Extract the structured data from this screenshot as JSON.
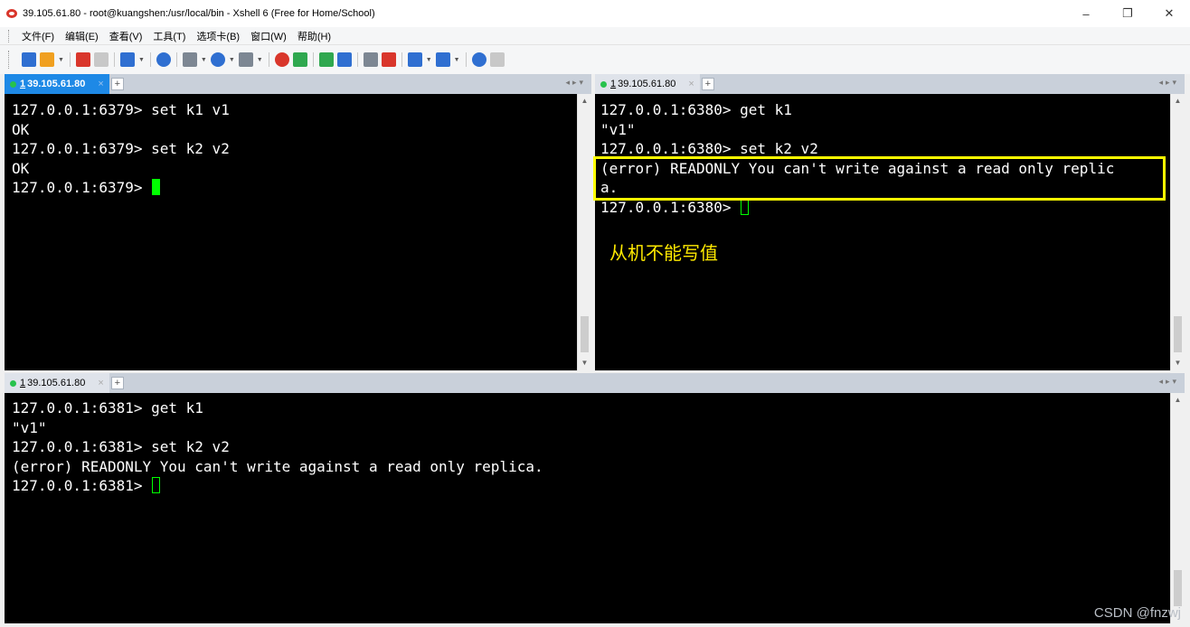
{
  "window": {
    "title": "39.105.61.80 - root@kuangshen:/usr/local/bin - Xshell 6 (Free for Home/School)",
    "controls": {
      "minimize": "–",
      "maximize": "❐",
      "close": "✕"
    }
  },
  "menu": [
    "文件(F)",
    "编辑(E)",
    "查看(V)",
    "工具(T)",
    "选项卡(B)",
    "窗口(W)",
    "帮助(H)"
  ],
  "toolbar": {
    "icons": [
      "new-session-icon",
      "open-folder-icon",
      "reconnect-icon",
      "disconnect-icon",
      "properties-icon",
      "find-icon",
      "transfer-icon",
      "globe-icon",
      "font-icon",
      "xshell-logo-icon",
      "xftp-icon",
      "fullscreen-icon",
      "lock-icon",
      "keyboard-icon",
      "script-icon",
      "layout-icon",
      "tab-layout-icon",
      "help-icon",
      "chat-icon"
    ],
    "colors": {
      "blue": "#2f6fd1",
      "orange": "#f0a020",
      "red": "#d9362b",
      "green": "#2fa84f",
      "gray": "#7d8793"
    }
  },
  "panes": {
    "top_left": {
      "tab": {
        "num": "1",
        "label": "39.105.61.80"
      },
      "lines": [
        "127.0.0.1:6379> set k1 v1",
        "OK",
        "127.0.0.1:6379> set k2 v2",
        "OK",
        "127.0.0.1:6379> "
      ]
    },
    "top_right": {
      "tab": {
        "num": "1",
        "label": "39.105.61.80"
      },
      "lines": [
        "127.0.0.1:6380> get k1",
        "\"v1\"",
        "127.0.0.1:6380> set k2 v2",
        "(error) READONLY You can't write against a read only replic",
        "a.",
        "127.0.0.1:6380> "
      ],
      "annotation": "从机不能写值"
    },
    "bottom": {
      "tab": {
        "num": "1",
        "label": "39.105.61.80"
      },
      "lines": [
        "127.0.0.1:6381> get k1",
        "\"v1\"",
        "127.0.0.1:6381> set k2 v2",
        "(error) READONLY You can't write against a read only replica.",
        "127.0.0.1:6381> "
      ]
    }
  },
  "watermark": "CSDN @fnzwj",
  "colors": {
    "active_tab": "#1e89e6",
    "cursor": "#00ff00",
    "highlight": "#ffff00",
    "annotation": "#ffea00",
    "status_dot": "#27c24c"
  }
}
